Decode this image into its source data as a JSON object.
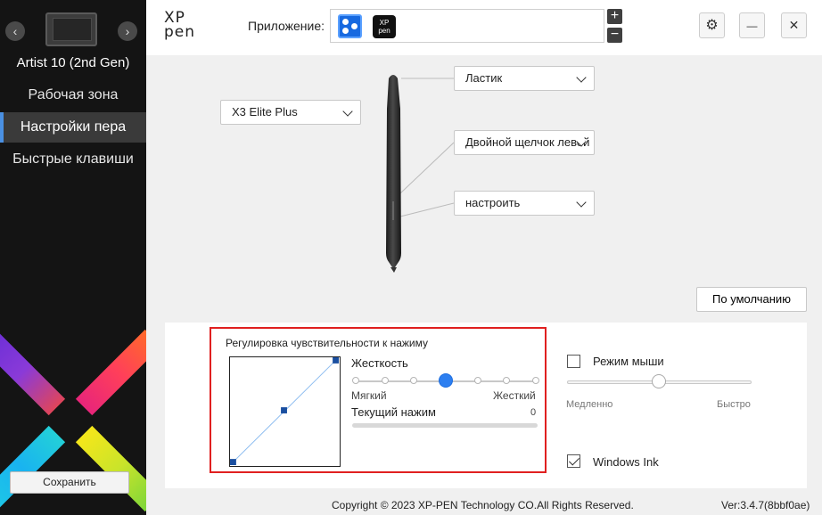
{
  "sidebar": {
    "device_name": "Artist 10 (2nd Gen)",
    "prev_label": "‹",
    "next_label": "›",
    "nav": [
      {
        "label": "Рабочая зона",
        "active": false
      },
      {
        "label": "Настройки пера",
        "active": true
      },
      {
        "label": "Быстрые клавиши",
        "active": false
      }
    ],
    "save_label": "Сохранить"
  },
  "header": {
    "logo_top": "XP",
    "logo_bottom": "pen",
    "app_label": "Приложение:",
    "app_add": "+",
    "app_remove": "−",
    "xp_icon_top": "XP",
    "xp_icon_bottom": "pen",
    "settings_icon": "⚙",
    "minimize_icon": "—",
    "close_icon": "✕"
  },
  "pen": {
    "model": "X3 Elite Plus",
    "top_button": "Ластик",
    "upper_button": "Двойной щелчок левой",
    "lower_button": "настроить",
    "default_label": "По умолчанию"
  },
  "pressure": {
    "title": "Регулировка чувствительности к нажиму",
    "hardness_label": "Жесткость",
    "soft_label": "Мягкий",
    "hard_label": "Жесткий",
    "current_label": "Текущий нажим",
    "current_value": "0",
    "hardness_level": 0.5,
    "current_pressure": 0
  },
  "mouse": {
    "mode_label": "Режим мыши",
    "mode_checked": false,
    "slow_label": "Медленно",
    "fast_label": "Быстро",
    "speed_level": 0.5
  },
  "windows_ink": {
    "label": "Windows Ink",
    "checked": true
  },
  "footer": {
    "copyright": "Copyright © 2023  XP-PEN Technology CO.All Rights Reserved.",
    "version": "Ver:3.4.7(8bbf0ae)"
  },
  "colors": {
    "accent": "#2d7ff0",
    "highlight": "#e02020",
    "sidebar": "#141414"
  }
}
